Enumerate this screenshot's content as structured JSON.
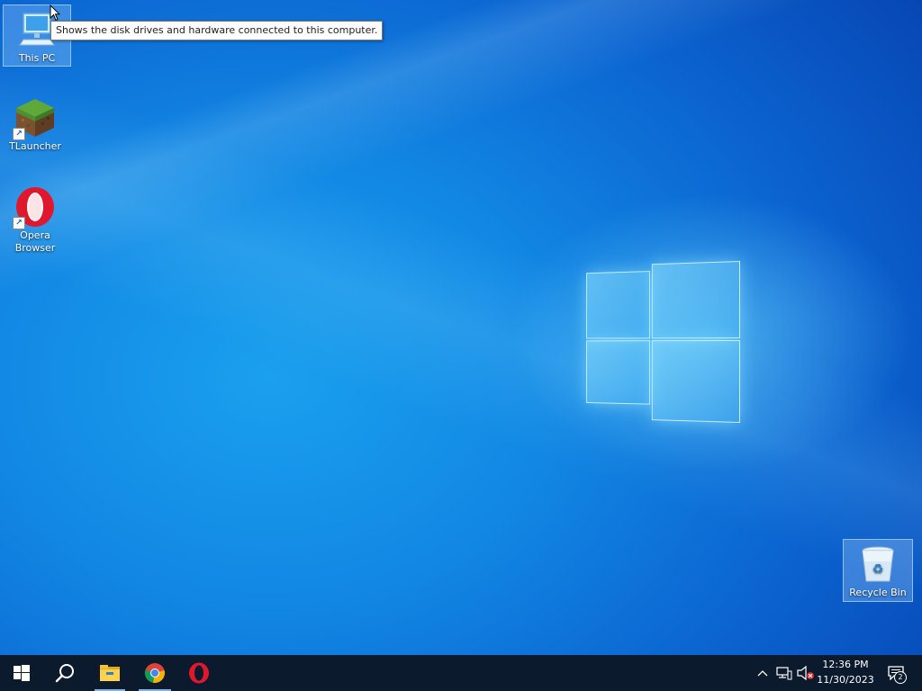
{
  "desktop": {
    "icons": [
      {
        "label": "This PC"
      },
      {
        "label": "TLauncher"
      },
      {
        "label": "Opera\nBrowser"
      },
      {
        "label": "Recycle Bin"
      }
    ],
    "tooltip": "Shows the disk drives and hardware connected to this computer."
  },
  "taskbar": {
    "start": "windows-start-icon",
    "search": "search-icon",
    "pinned": [
      "file-explorer-icon",
      "chrome-icon",
      "opera-icon"
    ],
    "tray": {
      "time": "12:36 PM",
      "date": "11/30/2023",
      "notifications_count": "2"
    }
  },
  "colors": {
    "taskbar_bg": "#0c1a2e",
    "desktop_blue": "#0a6fd6"
  }
}
